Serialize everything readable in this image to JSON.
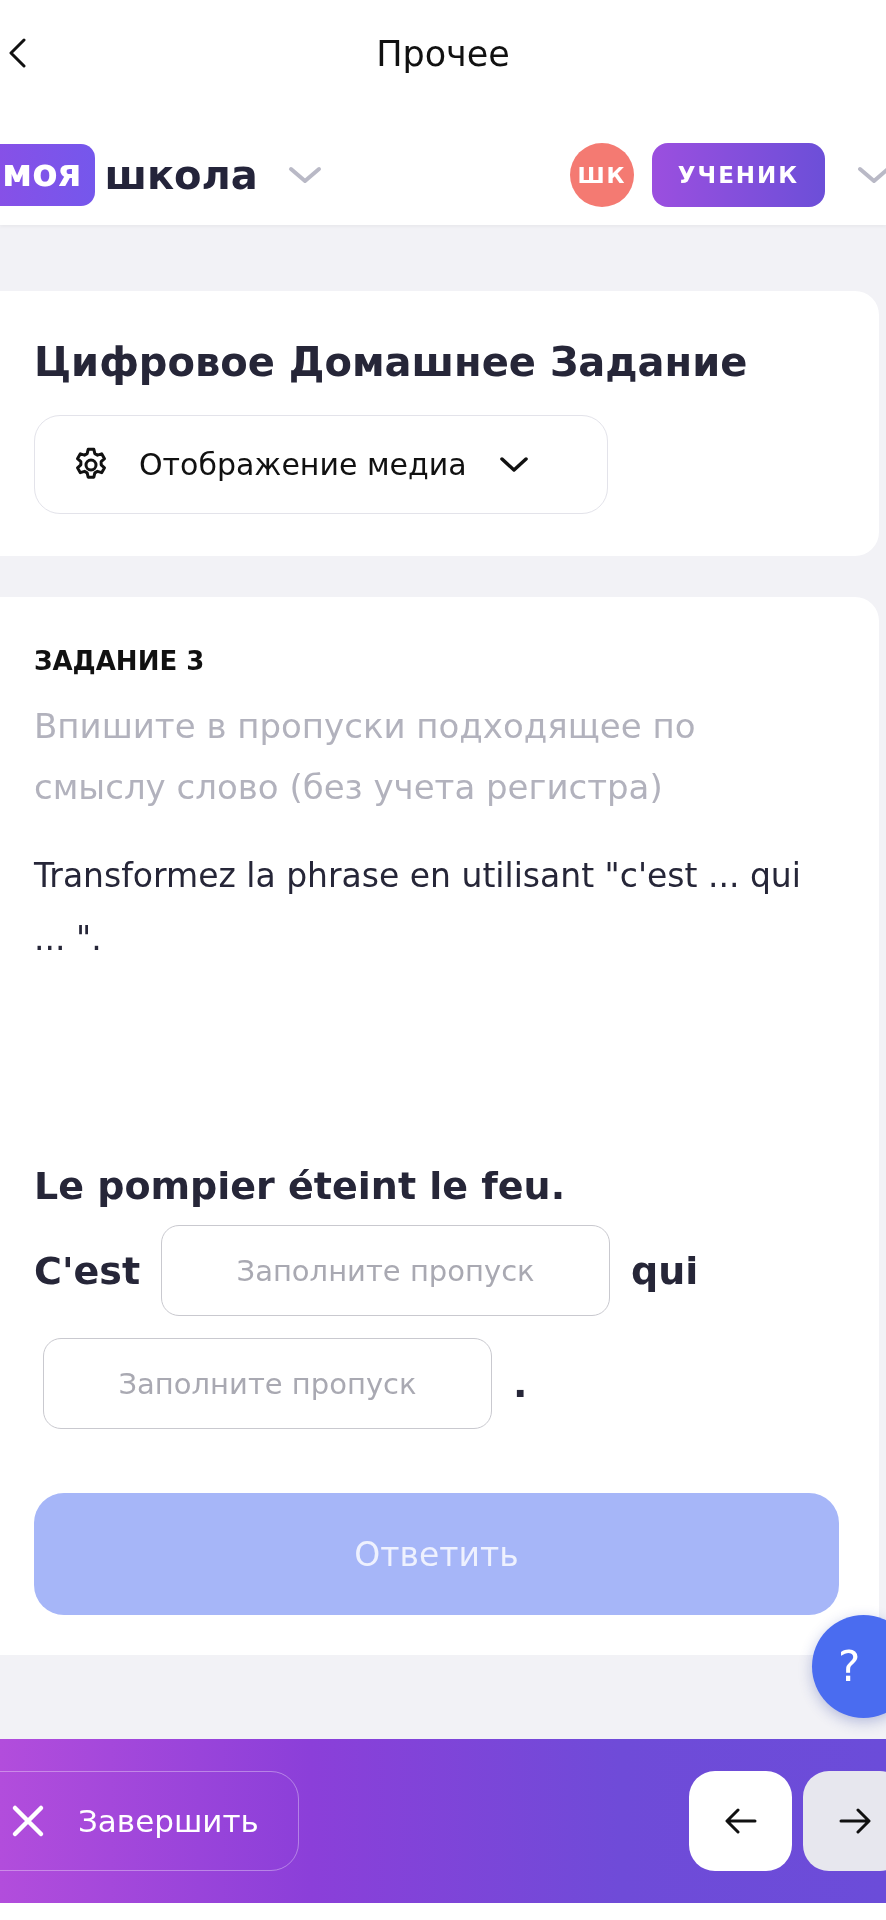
{
  "nav": {
    "title": "Прочее"
  },
  "header": {
    "logo": {
      "badge": "моя",
      "text": "школа"
    },
    "avatar": "ШК",
    "role": "УЧЕНИК"
  },
  "course_card": {
    "title": "Цифровое Домашнее Задание",
    "media_dropdown": {
      "label": "Отображение медиа"
    }
  },
  "task": {
    "number": "ЗАДАНИЕ 3",
    "hint": "Впишите в пропуски подходящее по смыслу слово (без учета регистра)",
    "instruction": "Transformez la phrase en utilisant \"c'est ... qui ... \".",
    "sentence": "Le pompier éteint le feu.",
    "parts": [
      {
        "kind": "text",
        "text": "C'est"
      },
      {
        "kind": "blank",
        "placeholder": "Заполните пропуск"
      },
      {
        "kind": "text",
        "text": "qui"
      },
      {
        "kind": "blank",
        "placeholder": "Заполните пропуск"
      },
      {
        "kind": "text",
        "text": "."
      }
    ],
    "submit": {
      "label": "Ответить",
      "disabled": true
    }
  },
  "help_button": {
    "label": "?"
  },
  "footer": {
    "finish": {
      "label": "Завершить"
    },
    "nav_buttons": [
      {
        "kind": "prev",
        "disabled": false
      },
      {
        "kind": "next",
        "disabled": true
      }
    ]
  }
}
